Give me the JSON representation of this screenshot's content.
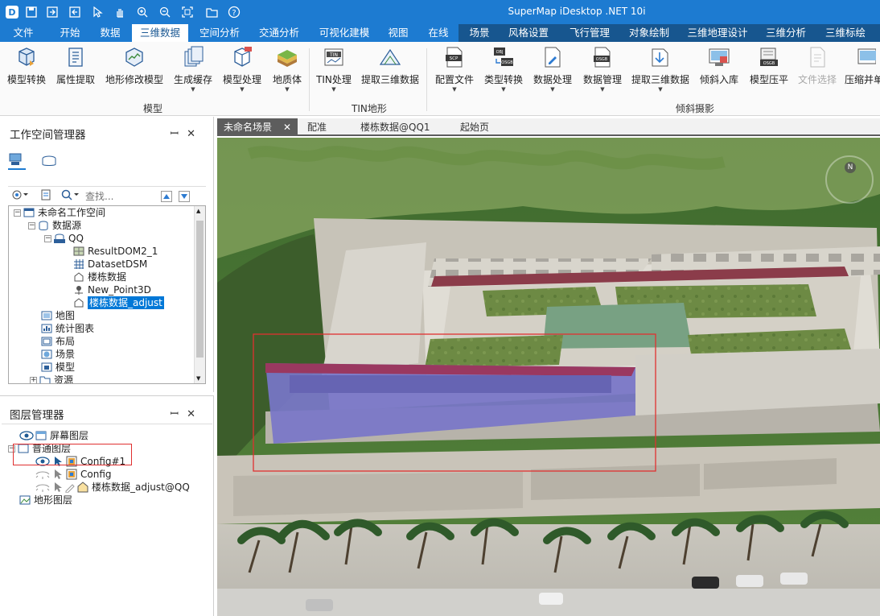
{
  "app": {
    "title": "SuperMap iDesktop .NET 10i"
  },
  "menu": {
    "tabs": [
      "文件",
      "开始",
      "数据",
      "三维数据",
      "空间分析",
      "交通分析",
      "可视化建模",
      "视图",
      "在线"
    ],
    "active": "三维数据",
    "context_tabs": [
      "场景",
      "风格设置",
      "飞行管理",
      "对象绘制",
      "三维地理设计",
      "三维分析",
      "三维标绘"
    ]
  },
  "ribbon": {
    "groups": {
      "model": "模型",
      "tin": "TIN地形",
      "oblique": "倾斜摄影"
    },
    "buttons": {
      "model_convert": "模型转换",
      "attr_extract": "属性提取",
      "terrain_modify": "地形修改模型",
      "gen_cache": "生成缓存",
      "model_process": "模型处理",
      "geo_body": "地质体",
      "tin_process": "TIN处理",
      "extract_3d": "提取三维数据",
      "config_file": "配置文件",
      "type_convert": "类型转换",
      "data_process": "数据处理",
      "data_manage": "数据管理",
      "extract_3d_2": "提取三维数据",
      "oblique_import": "倾斜入库",
      "model_flatten": "模型压平",
      "file_select": "文件选择",
      "compress": "压缩并单"
    }
  },
  "workspace_panel": {
    "title": "工作空间管理器",
    "search_placeholder": "查找...",
    "tree": {
      "root": "未命名工作空间",
      "datasources": "数据源",
      "qq": "QQ",
      "datasets": [
        "ResultDOM2_1",
        "DatasetDSM",
        "楼栋数据",
        "New_Point3D",
        "楼栋数据_adjust"
      ],
      "maps": "地图",
      "charts": "统计图表",
      "layouts": "布局",
      "scenes": "场景",
      "models": "模型",
      "resources": "资源"
    }
  },
  "layer_panel": {
    "title": "图层管理器",
    "screen_layer": "屏幕图层",
    "normal_layer": "普通图层",
    "config1": "Config#1",
    "config": "Config",
    "building_layer": "楼栋数据_adjust@QQ",
    "terrain_layer": "地形图层"
  },
  "doc_tabs": {
    "tabs": [
      "未命名场景",
      "配准",
      "楼栋数据@QQ1",
      "起始页"
    ],
    "active": "未命名场景"
  },
  "scene": {
    "compass": "N"
  },
  "colors": {
    "accent": "#1d7bd1",
    "context_tab": "#17568f",
    "highlight": "#0078d7",
    "annotation_box": "#e03030"
  }
}
